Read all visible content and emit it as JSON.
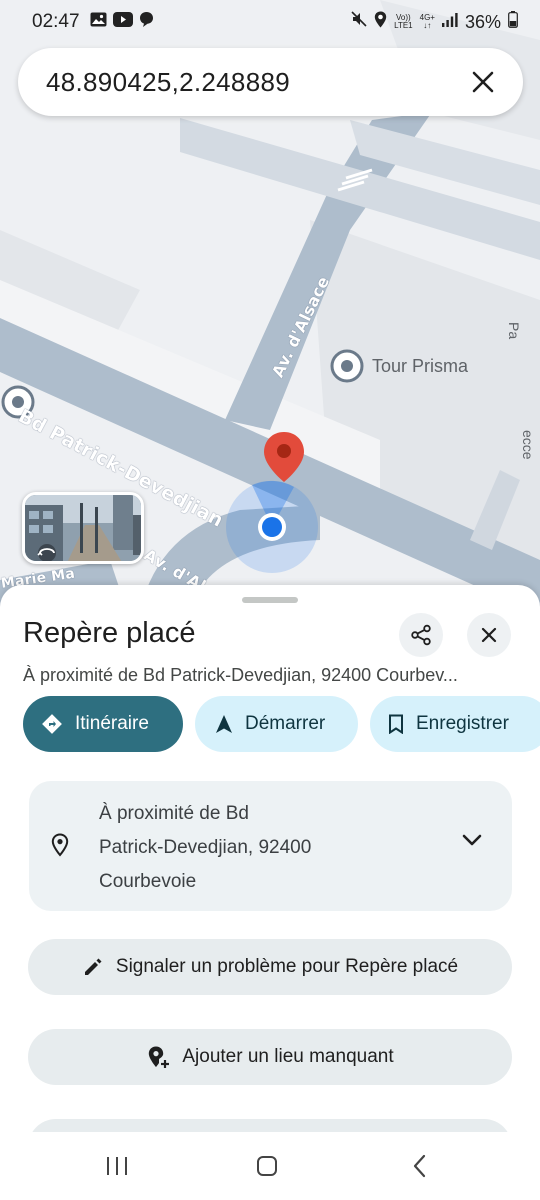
{
  "status_bar": {
    "time": "02:47",
    "network_top": "Vo))",
    "network_bottom": "LTE1",
    "net_type": "4G+",
    "battery": "36%",
    "icons_left": [
      "image-icon",
      "youtube-icon",
      "chat-icon"
    ],
    "icons_right": [
      "mute-icon",
      "location-icon",
      "signal-icon",
      "battery-icon"
    ]
  },
  "search": {
    "query": "48.890425,2.248889"
  },
  "map": {
    "street_labels": [
      "Bd Patrick-Devedjian",
      "Av. d'Alsace",
      "Av. d'Alsace",
      "Marie Ma"
    ],
    "poi_label": "Tour Prisma",
    "edge_label_right": "Pa",
    "edge_label_right2": "ecce"
  },
  "sheet": {
    "title": "Repère placé",
    "subtitle": "À proximité de Bd Patrick-Devedjian, 92400 Courbev...",
    "actions": {
      "directions": "Itinéraire",
      "start": "Démarrer",
      "save": "Enregistrer"
    },
    "address_lines": [
      "À proximité de Bd",
      "Patrick-Devedjian, 92400",
      "Courbevoie"
    ],
    "report_label": "Signaler un problème pour Repère placé",
    "add_place_label": "Ajouter un lieu manquant"
  },
  "colors": {
    "primary": "#2e6f80",
    "chip_secondary": "#d6f1fb",
    "road": "#aebdcc",
    "pin_red": "#e24b3b",
    "location_blue": "#1a73e8"
  }
}
